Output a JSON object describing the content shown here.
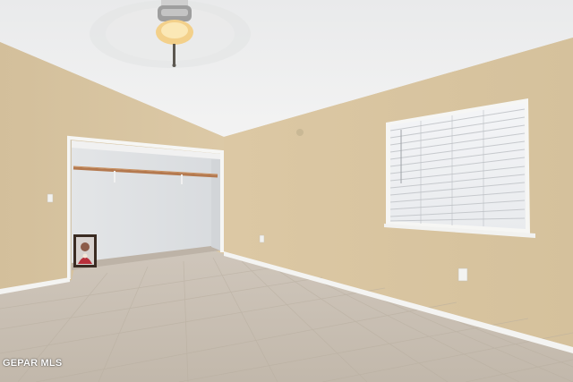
{
  "watermark": {
    "text": "GEPAR MLS"
  },
  "scene": {
    "description_icons": [
      "ceiling-fan-icon",
      "window-blinds-icon",
      "outlet-icon",
      "light-switch-icon",
      "framed-picture-icon"
    ],
    "colors": {
      "wall": "#d7c4a0",
      "ceiling": "#eceded",
      "closet_interior": "#e6e8ea",
      "floor": "#c9bfb3",
      "trim": "#f5f5f3",
      "window": "#f2f3f5"
    }
  }
}
